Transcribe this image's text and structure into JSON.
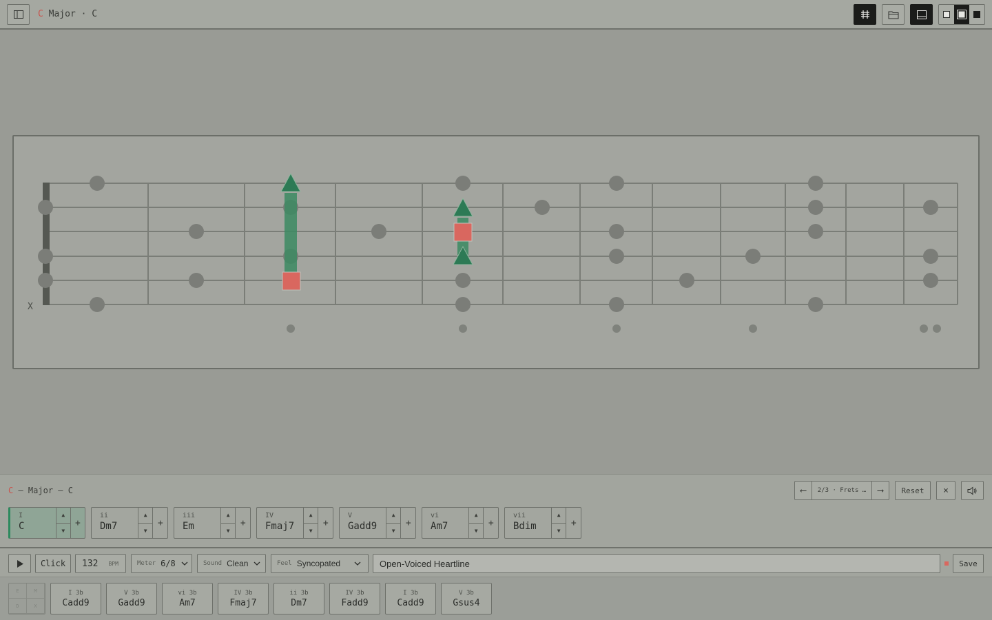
{
  "header": {
    "key": "C",
    "title_rest": "Major · C",
    "icons": [
      "sidebar-toggle-icon",
      "grid-icon",
      "folder-icon",
      "panel-bottom-icon",
      "layout-small-icon",
      "layout-medium-icon",
      "layout-full-icon"
    ]
  },
  "fretboard": {
    "strings": 6,
    "open_marker": "X"
  },
  "chord_panel": {
    "key": "C",
    "title_rest": "– Major – C",
    "position_label": "2/3 · Frets …",
    "prev_arrow": "⟵",
    "next_arrow": "⟶",
    "reset_label": "Reset",
    "close_label": "×",
    "chords": [
      {
        "roman": "I",
        "name": "C",
        "active": true
      },
      {
        "roman": "ii",
        "name": "Dm7"
      },
      {
        "roman": "iii",
        "name": "Em"
      },
      {
        "roman": "IV",
        "name": "Fmaj7"
      },
      {
        "roman": "V",
        "name": "Gadd9"
      },
      {
        "roman": "vi",
        "name": "Am7"
      },
      {
        "roman": "vii",
        "name": "Bdim"
      }
    ],
    "up": "▲",
    "down": "▼",
    "plus": "+"
  },
  "transport": {
    "click_label": "Click",
    "bpm_value": "132",
    "bpm_label": "BPM",
    "meter_label": "Meter",
    "meter_value": "6/8",
    "sound_label": "Sound",
    "sound_value": "Clean",
    "feel_label": "Feel",
    "feel_value": "Syncopated",
    "name_value": "Open-Voiced Heartline",
    "save_label": "Save"
  },
  "progression": {
    "grid_cells": [
      "E",
      "M",
      "D",
      "X"
    ],
    "items": [
      {
        "sub": "I 3b",
        "name": "Cadd9"
      },
      {
        "sub": "V 3b",
        "name": "Gadd9"
      },
      {
        "sub": "vi 3b",
        "name": "Am7"
      },
      {
        "sub": "IV 3b",
        "name": "Fmaj7"
      },
      {
        "sub": "ii 3b",
        "name": "Dm7"
      },
      {
        "sub": "IV 3b",
        "name": "Fadd9"
      },
      {
        "sub": "I 3b",
        "name": "Cadd9"
      },
      {
        "sub": "V 3b",
        "name": "Gsus4"
      }
    ]
  },
  "colors": {
    "accent_green": "#2d8a5e",
    "accent_red": "#d9675f",
    "note_gray": "#7b7d78"
  }
}
